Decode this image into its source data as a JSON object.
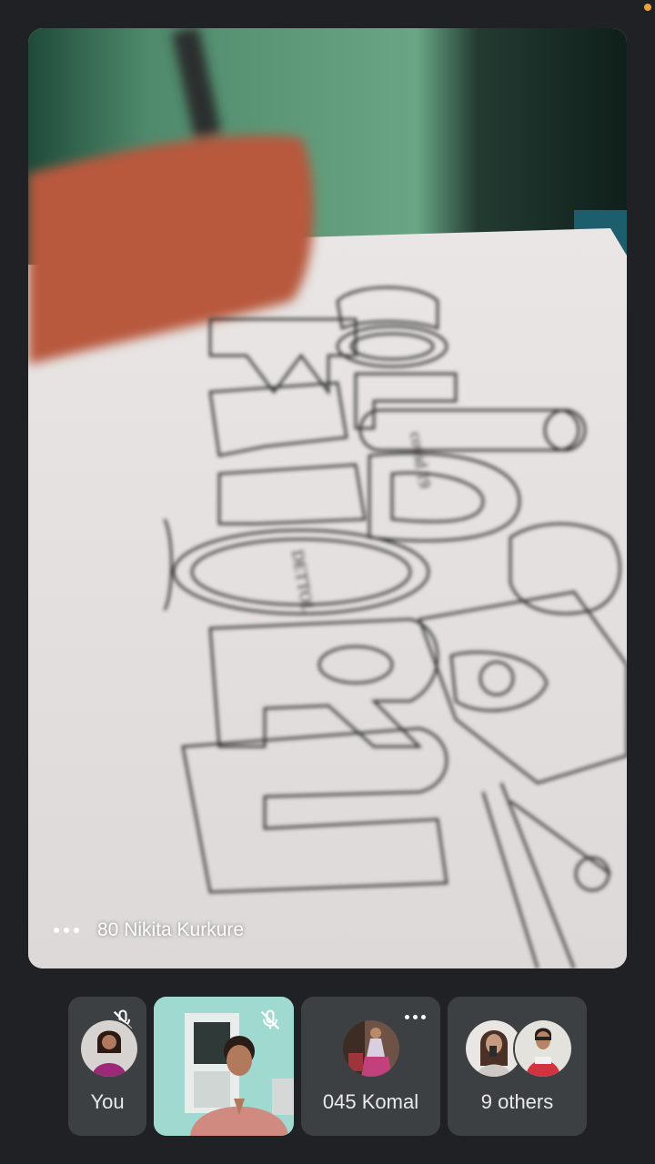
{
  "main_tile": {
    "participant_name": "80 Nikita Kurkure",
    "drawing_words": [
      "COVID",
      "WARRIORS"
    ],
    "drawing_labels": [
      "covid 19",
      "DETTOL"
    ]
  },
  "participants": [
    {
      "label": "You",
      "muted": true
    },
    {
      "label": "",
      "muted": true
    },
    {
      "label": "045 Komal",
      "muted": false
    },
    {
      "label": "9 others",
      "muted": false
    }
  ],
  "colors": {
    "background": "#202124",
    "tile": "#3c4043",
    "status_dot": "#e8a33d"
  },
  "icons": [
    "more-options-icon",
    "mic-off-icon"
  ]
}
